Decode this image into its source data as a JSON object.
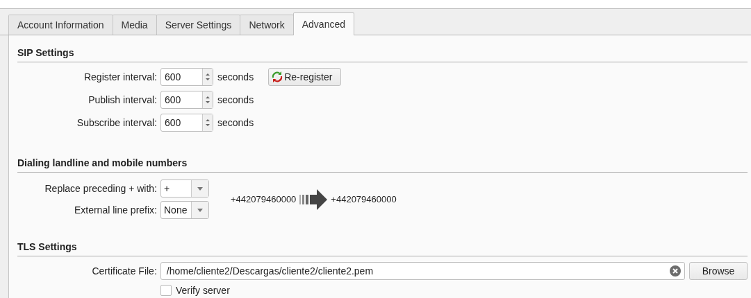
{
  "tabs": [
    {
      "label": "Account Information",
      "selected": false
    },
    {
      "label": "Media",
      "selected": false
    },
    {
      "label": "Server Settings",
      "selected": false
    },
    {
      "label": "Network",
      "selected": false
    },
    {
      "label": "Advanced",
      "selected": true
    }
  ],
  "sip_settings": {
    "title": "SIP Settings",
    "rows": [
      {
        "label": "Register interval:",
        "value": "600",
        "unit": "seconds"
      },
      {
        "label": "Publish interval:",
        "value": "600",
        "unit": "seconds"
      },
      {
        "label": "Subscribe interval:",
        "value": "600",
        "unit": "seconds"
      }
    ],
    "reregister_button": "Re-register"
  },
  "dialing": {
    "title": "Dialing landline and mobile numbers",
    "rows": [
      {
        "label": "Replace preceding + with:",
        "value": "+"
      },
      {
        "label": "External line prefix:",
        "value": "None"
      }
    ],
    "example_input": "+442079460000",
    "example_output": "+442079460000"
  },
  "tls": {
    "title": "TLS Settings",
    "certificate_label": "Certificate File:",
    "certificate_value": "/home/cliente2/Descargas/cliente2/cliente2.pem",
    "browse_button": "Browse",
    "verify_server": {
      "label": "Verify server",
      "checked": false
    }
  }
}
